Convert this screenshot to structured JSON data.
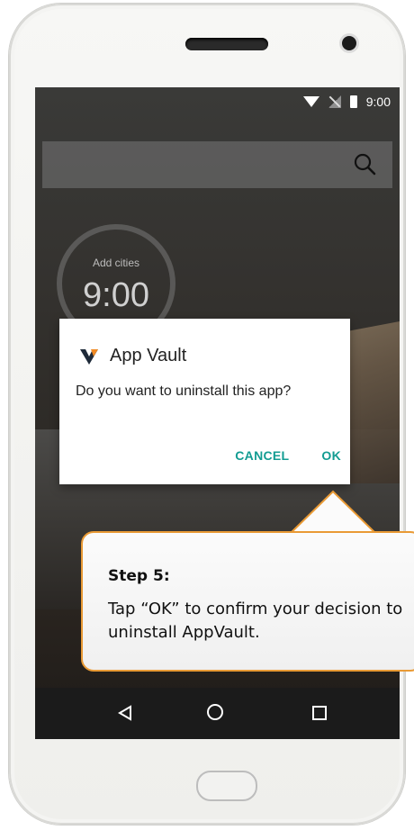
{
  "status": {
    "time": "9:00"
  },
  "search": {
    "icon": "search-icon"
  },
  "clock_widget": {
    "cities_label": "Add cities",
    "time": "9:00"
  },
  "dialog": {
    "app_name": "App Vault",
    "message": "Do you want to uninstall this app?",
    "cancel_label": "CANCEL",
    "ok_label": "OK",
    "accent_color": "#139c92"
  },
  "callout": {
    "title": "Step 5:",
    "text": "Tap “OK” to confirm your decision to uninstall AppVault.",
    "border_color": "#e99a35"
  },
  "navbar": {
    "back_icon": "back-icon",
    "home_icon": "home-icon",
    "recents_icon": "recents-icon"
  }
}
